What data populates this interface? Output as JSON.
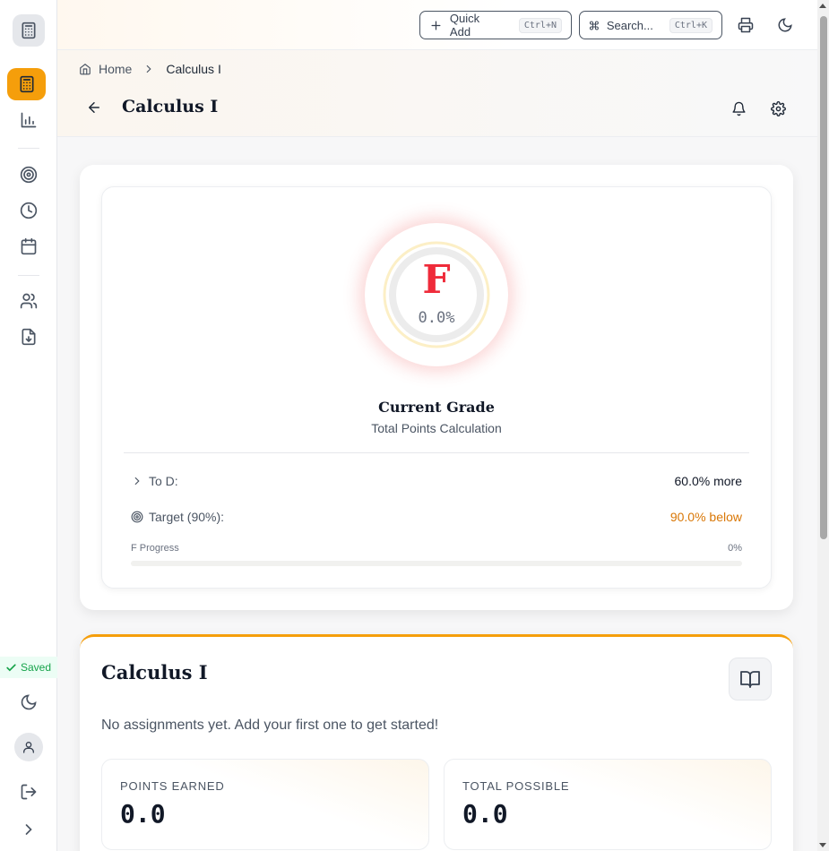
{
  "topbar": {
    "quick_add_label": "Quick Add",
    "quick_add_shortcut": "Ctrl+N",
    "search_label": "Search...",
    "search_shortcut": "Ctrl+K"
  },
  "breadcrumb": {
    "home": "Home",
    "current": "Calculus I"
  },
  "page": {
    "title": "Calculus I"
  },
  "grade": {
    "letter": "F",
    "percent": "0.0%",
    "title": "Current Grade",
    "subtitle": "Total Points Calculation",
    "to_next_label": "To D:",
    "to_next_value": "60.0% more",
    "target_label": "Target (90%):",
    "target_value": "90.0% below",
    "progress_label": "F Progress",
    "progress_value": "0%",
    "progress_fraction": 0.0
  },
  "course": {
    "title": "Calculus I",
    "empty_message": "No assignments yet. Add your first one to get started!",
    "stats": [
      {
        "label": "POINTS EARNED",
        "value": "0.0"
      },
      {
        "label": "TOTAL POSSIBLE",
        "value": "0.0"
      }
    ]
  },
  "sidebar": {
    "saved_label": "Saved"
  },
  "colors": {
    "accent": "#f59e0b",
    "grade_fail": "#ef2b3a",
    "warning_text": "#d97706",
    "success": "#16a34a"
  },
  "icons": {
    "sidebar": [
      "calculator-icon",
      "calculator-icon",
      "bar-chart-icon",
      "target-icon",
      "clock-icon",
      "calendar-icon",
      "users-icon",
      "file-download-icon",
      "moon-icon",
      "user-icon",
      "logout-icon",
      "chevron-right-icon"
    ],
    "topbar": [
      "plus-icon",
      "command-icon",
      "printer-icon",
      "moon-icon"
    ],
    "header": [
      "home-icon",
      "chevron-right-icon",
      "arrow-left-icon",
      "bell-icon",
      "gear-icon"
    ]
  }
}
